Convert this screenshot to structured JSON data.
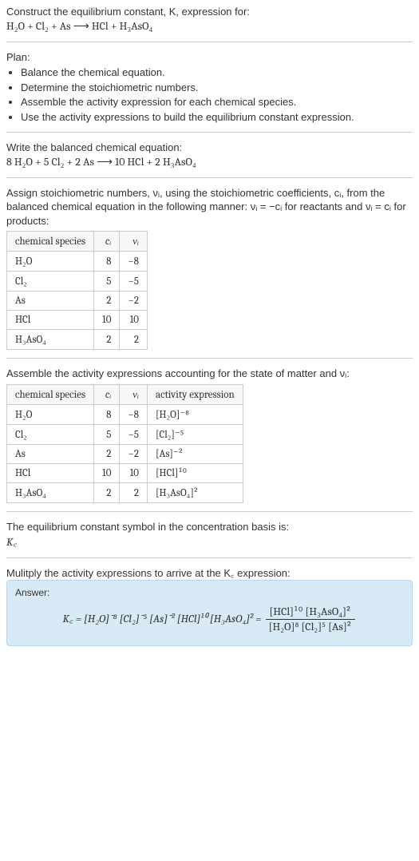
{
  "header": {
    "title": "Construct the equilibrium constant, K, expression for:",
    "equation": "H₂O + Cl₂ + As ⟶ HCl + H₃AsO₄"
  },
  "plan": {
    "label": "Plan:",
    "items": [
      "Balance the chemical equation.",
      "Determine the stoichiometric numbers.",
      "Assemble the activity expression for each chemical species.",
      "Use the activity expressions to build the equilibrium constant expression."
    ]
  },
  "balanced": {
    "label": "Write the balanced chemical equation:",
    "equation": "8 H₂O + 5 Cl₂ + 2 As ⟶ 10 HCl + 2 H₃AsO₄"
  },
  "stoich_intro": "Assign stoichiometric numbers, νᵢ, using the stoichiometric coefficients, cᵢ, from the balanced chemical equation in the following manner: νᵢ = −cᵢ for reactants and νᵢ = cᵢ for products:",
  "table1": {
    "headers": [
      "chemical species",
      "cᵢ",
      "νᵢ"
    ],
    "rows": [
      {
        "species": "H₂O",
        "c": "8",
        "v": "−8"
      },
      {
        "species": "Cl₂",
        "c": "5",
        "v": "−5"
      },
      {
        "species": "As",
        "c": "2",
        "v": "−2"
      },
      {
        "species": "HCl",
        "c": "10",
        "v": "10"
      },
      {
        "species": "H₃AsO₄",
        "c": "2",
        "v": "2"
      }
    ]
  },
  "activity_intro": "Assemble the activity expressions accounting for the state of matter and νᵢ:",
  "table2": {
    "headers": [
      "chemical species",
      "cᵢ",
      "νᵢ",
      "activity expression"
    ],
    "rows": [
      {
        "species": "H₂O",
        "c": "8",
        "v": "−8",
        "act": "[H₂O]⁻⁸"
      },
      {
        "species": "Cl₂",
        "c": "5",
        "v": "−5",
        "act": "[Cl₂]⁻⁵"
      },
      {
        "species": "As",
        "c": "2",
        "v": "−2",
        "act": "[As]⁻²"
      },
      {
        "species": "HCl",
        "c": "10",
        "v": "10",
        "act": "[HCl]¹⁰"
      },
      {
        "species": "H₃AsO₄",
        "c": "2",
        "v": "2",
        "act": "[H₃AsO₄]²"
      }
    ]
  },
  "kc_symbol": {
    "line1": "The equilibrium constant symbol in the concentration basis is:",
    "line2": "K꜀"
  },
  "multiply": "Mulitply the activity expressions to arrive at the K꜀ expression:",
  "answer": {
    "label": "Answer:",
    "prefix": "K꜀ = [H₂O]⁻⁸ [Cl₂]⁻⁵ [As]⁻² [HCl]¹⁰ [H₃AsO₄]² =",
    "frac_num": "[HCl]¹⁰ [H₃AsO₄]²",
    "frac_den": "[H₂O]⁸ [Cl₂]⁵ [As]²"
  },
  "chart_data": {
    "type": "table",
    "tables": [
      {
        "title": "Stoichiometric numbers",
        "columns": [
          "chemical species",
          "c_i",
          "ν_i"
        ],
        "rows": [
          [
            "H2O",
            8,
            -8
          ],
          [
            "Cl2",
            5,
            -5
          ],
          [
            "As",
            2,
            -2
          ],
          [
            "HCl",
            10,
            10
          ],
          [
            "H3AsO4",
            2,
            2
          ]
        ]
      },
      {
        "title": "Activity expressions",
        "columns": [
          "chemical species",
          "c_i",
          "ν_i",
          "activity expression"
        ],
        "rows": [
          [
            "H2O",
            8,
            -8,
            "[H2O]^-8"
          ],
          [
            "Cl2",
            5,
            -5,
            "[Cl2]^-5"
          ],
          [
            "As",
            2,
            -2,
            "[As]^-2"
          ],
          [
            "HCl",
            10,
            10,
            "[HCl]^10"
          ],
          [
            "H3AsO4",
            2,
            2,
            "[H3AsO4]^2"
          ]
        ]
      }
    ],
    "equilibrium_constant": "Kc = ([HCl]^10 * [H3AsO4]^2) / ([H2O]^8 * [Cl2]^5 * [As]^2)"
  }
}
